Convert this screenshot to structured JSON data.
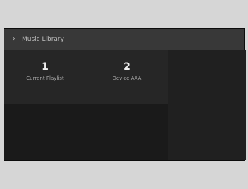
{
  "header": {
    "title": "Music Library",
    "back_icon": "chevron-right-icon"
  },
  "sources": [
    {
      "number": "1",
      "label": "Current Playlist"
    },
    {
      "number": "2",
      "label": "Device AAA"
    }
  ],
  "colors": {
    "background": "#d6d6d6",
    "screen": "#1a1a1a",
    "header": "#383838",
    "tile": "#262626",
    "text": "#efefef"
  }
}
